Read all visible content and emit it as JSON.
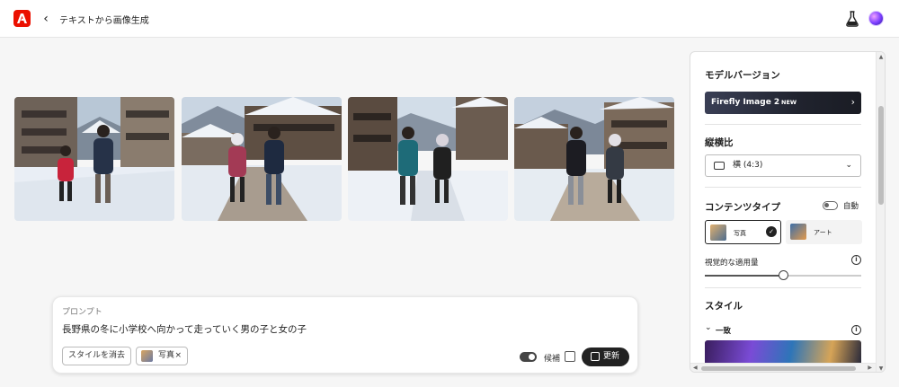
{
  "header": {
    "back_icon": "chevron-left-icon",
    "title": "テキストから画像生成",
    "brand_color": "#eb1000"
  },
  "images": [
    {
      "alt": "image-1"
    },
    {
      "alt": "image-2"
    },
    {
      "alt": "image-3"
    },
    {
      "alt": "image-4"
    }
  ],
  "prompt": {
    "label": "プロンプト",
    "text": "長野県の冬に小学校へ向かって走っていく男の子と女の子",
    "clear_style_label": "スタイルを消去",
    "photo_chip_label": "写真",
    "remove_symbol": "×",
    "candidates_label": "候補",
    "update_label": "更新"
  },
  "panel": {
    "model_heading": "モデルバージョン",
    "model_name": "Firefly Image 2",
    "model_badge": "NEW",
    "ratio_heading": "縦横比",
    "ratio_value": "横 (4:3)",
    "content_type_heading": "コンテンツタイプ",
    "auto_label": "自動",
    "content_types": [
      {
        "label": "写真",
        "selected": true
      },
      {
        "label": "アート",
        "selected": false
      }
    ],
    "visual_intensity_label": "視覚的な適用量",
    "visual_intensity_fraction": 0.5,
    "style_heading": "スタイル",
    "style_group_label": "一致"
  }
}
